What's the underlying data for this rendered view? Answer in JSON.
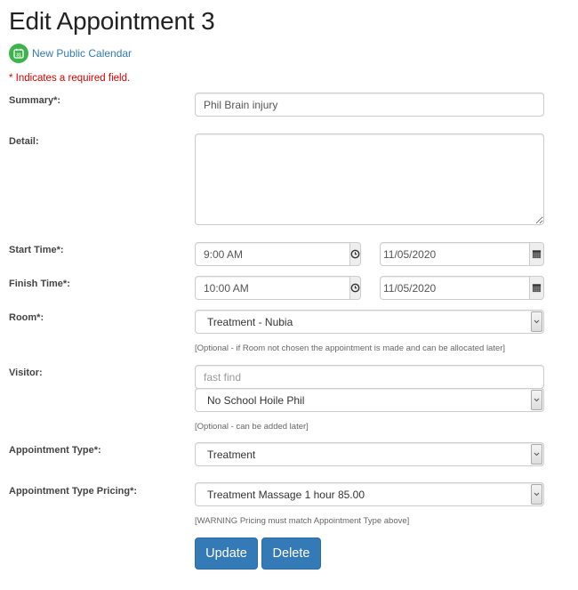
{
  "page": {
    "title": "Edit Appointment 3",
    "calendar_link": {
      "label": "New Public Calendar",
      "icon": "calendar-icon",
      "icon_color": "#3cb44b",
      "link_color": "#337ab7"
    },
    "required_note": "* Indicates a required field."
  },
  "form": {
    "summary": {
      "label": "Summary*:",
      "value": "Phil Brain injury"
    },
    "detail": {
      "label": "Detail:",
      "value": ""
    },
    "start_time": {
      "label": "Start Time*:",
      "time": "9:00 AM",
      "date": "11/05/2020",
      "time_icon": "clock-icon",
      "date_icon": "calendar-icon"
    },
    "finish_time": {
      "label": "Finish Time*:",
      "time": "10:00 AM",
      "date": "11/05/2020",
      "time_icon": "clock-icon",
      "date_icon": "calendar-icon"
    },
    "room": {
      "label": "Room*:",
      "selected": "Treatment - Nubia",
      "help": "[Optional - if Room not chosen the appointment is made and can be allocated later]"
    },
    "visitor": {
      "label": "Visitor:",
      "search_placeholder": "fast find",
      "search_value": "",
      "selected": "No School Hoile Phil",
      "help": "[Optional - can be added later]"
    },
    "appointment_type": {
      "label": "Appointment Type*:",
      "selected": "Treatment"
    },
    "pricing": {
      "label": "Appointment Type Pricing*:",
      "selected": "Treatment Massage 1 hour 85.00",
      "help": "[WARNING Pricing must match Appointment Type above]"
    }
  },
  "buttons": {
    "update": "Update",
    "delete": "Delete",
    "color": "#337ab7"
  }
}
